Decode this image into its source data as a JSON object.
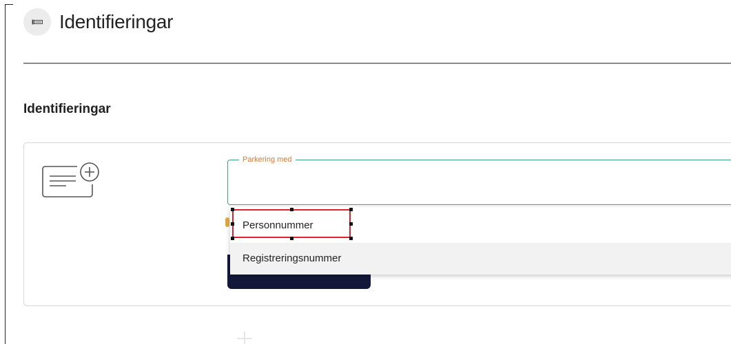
{
  "header": {
    "title": "Identifieringar",
    "icon": "parking-sign-icon"
  },
  "section": {
    "title": "Identifieringar"
  },
  "card": {
    "icon": "id-card-add-icon"
  },
  "field": {
    "label": "Parkering med",
    "value": ""
  },
  "dropdown": {
    "options": [
      {
        "label": "Personnummer"
      },
      {
        "label": "Registreringsnummer"
      }
    ]
  },
  "colors": {
    "field_border": "#3aa57a",
    "field_label": "#e07a2f",
    "button_bg": "#13183a",
    "selection_box": "#e0202a"
  }
}
